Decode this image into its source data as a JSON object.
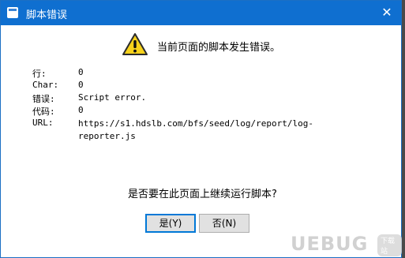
{
  "window": {
    "title": "脚本错误",
    "close_glyph": "✕"
  },
  "message": "当前页面的脚本发生错误。",
  "details": {
    "line_label": "行:",
    "line_value": "0",
    "char_label": "Char:",
    "char_value": "0",
    "error_label": "错误:",
    "error_value": "Script error.",
    "code_label": "代码:",
    "code_value": "0",
    "url_label": "URL:",
    "url_value": "https://s1.hdslb.com/bfs/seed/log/report/log-reporter.js"
  },
  "question": "是否要在此页面上继续运行脚本?",
  "buttons": {
    "yes_label": "是(Y)",
    "no_label": "否(N)"
  },
  "watermark": {
    "text": "UEBUG",
    "tag": "下载站"
  },
  "colors": {
    "titlebar": "#0f6fd0",
    "warning": "#f7d21b",
    "default_button_border": "#0078d7"
  },
  "icons": {
    "title": "script-error-icon",
    "warning": "warning-icon",
    "close": "close-icon"
  }
}
